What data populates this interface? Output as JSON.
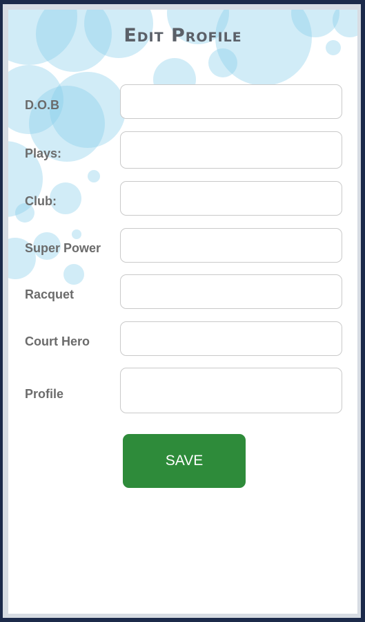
{
  "page": {
    "title": "Edit Profile"
  },
  "form": {
    "fields": [
      {
        "label": "D.O.B",
        "value": "",
        "placeholder": ""
      },
      {
        "label": "Plays:",
        "value": "",
        "placeholder": ""
      },
      {
        "label": "Club:",
        "value": "",
        "placeholder": ""
      },
      {
        "label": "Super Power",
        "value": "",
        "placeholder": ""
      },
      {
        "label": "Racquet",
        "value": "",
        "placeholder": ""
      },
      {
        "label": "Court Hero",
        "value": "",
        "placeholder": ""
      },
      {
        "label": "Profile",
        "value": "",
        "placeholder": ""
      }
    ],
    "save_label": "SAVE"
  },
  "colors": {
    "save_button": "#2e8b3a",
    "bubbles": "#87ceeb",
    "frame": "#1c2a4a"
  }
}
